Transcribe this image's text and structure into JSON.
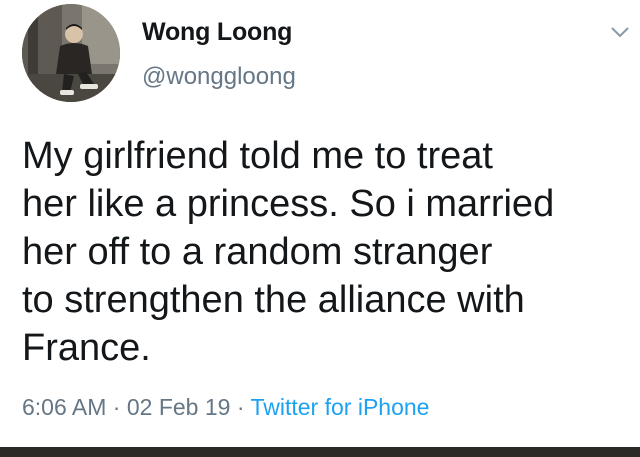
{
  "tweet": {
    "author": {
      "display_name": "Wong Loong",
      "handle": "@wonggloong",
      "avatar_icon": "profile-photo"
    },
    "menu_icon": "chevron-down-icon",
    "text_lines": [
      "My girlfriend told me to treat",
      "her like a princess. So i married",
      "her off to a random stranger",
      "to strengthen the alliance with",
      "France."
    ],
    "time": "6:06 AM",
    "separator": "·",
    "date": "02 Feb 19",
    "source": "Twitter for iPhone"
  },
  "colors": {
    "text": "#14171a",
    "secondary": "#657786",
    "link": "#1da1f2",
    "background": "#ffffff"
  }
}
